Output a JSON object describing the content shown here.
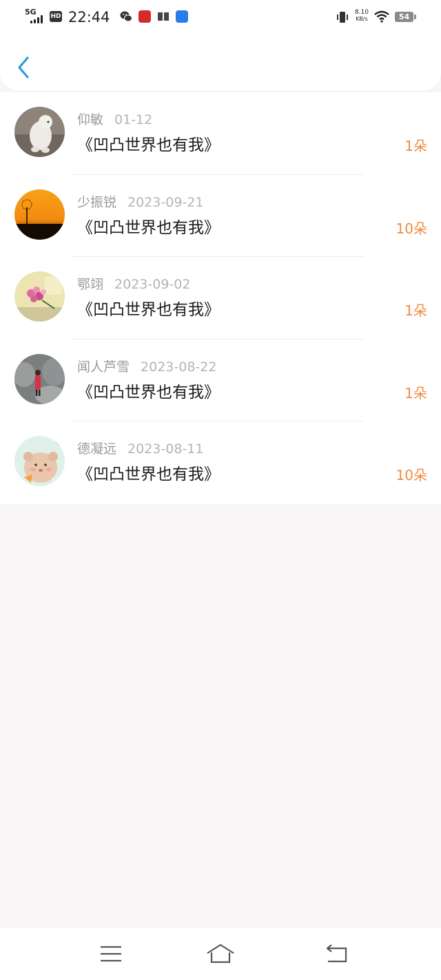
{
  "status_bar": {
    "network": "5G",
    "hd": "HD",
    "time": "22:44",
    "speed_value": "8.10",
    "speed_unit": "KB/s",
    "battery": "54"
  },
  "header": {
    "back_icon": "chevron-left-icon",
    "accent": "#2b9be0"
  },
  "items": [
    {
      "name": "仰敏",
      "date": "01-12",
      "title": "《凹凸世界也有我》",
      "count": "1朵"
    },
    {
      "name": "少振锐",
      "date": "2023-09-21",
      "title": "《凹凸世界也有我》",
      "count": "10朵"
    },
    {
      "name": "鄂翊",
      "date": "2023-09-02",
      "title": "《凹凸世界也有我》",
      "count": "1朵"
    },
    {
      "name": "闻人芦雪",
      "date": "2023-08-22",
      "title": "《凹凸世界也有我》",
      "count": "1朵"
    },
    {
      "name": "德凝远",
      "date": "2023-08-11",
      "title": "《凹凸世界也有我》",
      "count": "10朵"
    }
  ],
  "count_color": "#f08a3c",
  "nav": {
    "menu_icon": "menu-icon",
    "home_icon": "home-icon",
    "back_icon": "back-icon"
  }
}
